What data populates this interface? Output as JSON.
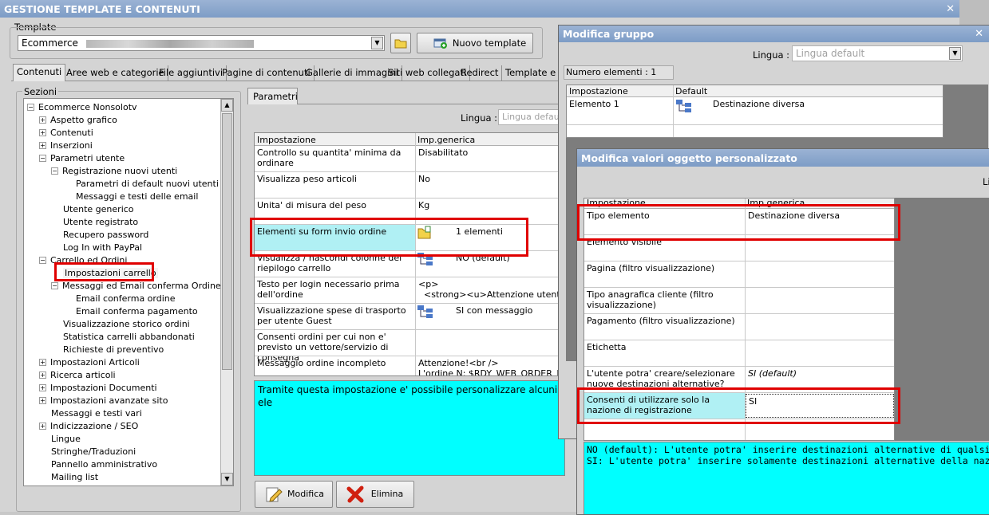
{
  "main_window": {
    "title": "GESTIONE TEMPLATE E CONTENUTI",
    "template_label": "Template",
    "template_value": "Ecommerce",
    "new_template_label": "Nuovo template"
  },
  "tabs": [
    "Contenuti",
    "Aree web e categorie",
    "File aggiuntivi",
    "Pagine di contenuti",
    "Gallerie di immagini",
    "Siti web collegati",
    "Redirect",
    "Template e pl"
  ],
  "sections_label": "Sezioni",
  "tree": [
    {
      "label": "Ecommerce Nonsolotv",
      "level": 0,
      "toggle": "−"
    },
    {
      "label": "Aspetto grafico",
      "level": 1,
      "toggle": "+"
    },
    {
      "label": "Contenuti",
      "level": 1,
      "toggle": "+"
    },
    {
      "label": "Inserzioni",
      "level": 1,
      "toggle": "+"
    },
    {
      "label": "Parametri utente",
      "level": 1,
      "toggle": "−"
    },
    {
      "label": "Registrazione nuovi utenti",
      "level": 2,
      "toggle": "−"
    },
    {
      "label": "Parametri di default nuovi utenti",
      "level": 3,
      "toggle": ""
    },
    {
      "label": "Messaggi e testi delle email",
      "level": 3,
      "toggle": ""
    },
    {
      "label": "Utente generico",
      "level": 2,
      "toggle": ""
    },
    {
      "label": "Utente registrato",
      "level": 2,
      "toggle": ""
    },
    {
      "label": "Recupero password",
      "level": 2,
      "toggle": ""
    },
    {
      "label": "Log In with PayPal",
      "level": 2,
      "toggle": ""
    },
    {
      "label": "Carrello ed Ordini",
      "level": 1,
      "toggle": "−"
    },
    {
      "label": "Impostazioni carrello",
      "level": 2,
      "toggle": "",
      "selected": true
    },
    {
      "label": "Messaggi ed Email conferma Ordine",
      "level": 2,
      "toggle": "−"
    },
    {
      "label": "Email conferma ordine",
      "level": 3,
      "toggle": ""
    },
    {
      "label": "Email conferma pagamento",
      "level": 3,
      "toggle": ""
    },
    {
      "label": "Visualizzazione storico ordini",
      "level": 2,
      "toggle": ""
    },
    {
      "label": "Statistica carrelli abbandonati",
      "level": 2,
      "toggle": ""
    },
    {
      "label": "Richieste di preventivo",
      "level": 2,
      "toggle": ""
    },
    {
      "label": "Impostazioni Articoli",
      "level": 1,
      "toggle": "+"
    },
    {
      "label": "Ricerca articoli",
      "level": 1,
      "toggle": "+"
    },
    {
      "label": "Impostazioni Documenti",
      "level": 1,
      "toggle": "+"
    },
    {
      "label": "Impostazioni avanzate sito",
      "level": 1,
      "toggle": "+"
    },
    {
      "label": "Messaggi e testi vari",
      "level": 1,
      "toggle": ""
    },
    {
      "label": "Indicizzazione / SEO",
      "level": 1,
      "toggle": "+"
    },
    {
      "label": "Lingue",
      "level": 1,
      "toggle": ""
    },
    {
      "label": "Stringhe/Traduzioni",
      "level": 1,
      "toggle": ""
    },
    {
      "label": "Pannello amministrativo",
      "level": 1,
      "toggle": ""
    },
    {
      "label": "Mailing list",
      "level": 1,
      "toggle": ""
    }
  ],
  "parametri": {
    "tab_label": "Parametri",
    "lingua_label": "Lingua :",
    "lingua_value": "Lingua defau",
    "col_impostazione": "Impostazione",
    "col_generica": "Imp.generica",
    "rows": [
      {
        "name": "Controllo su quantita' minima da ordinare",
        "value": "Disabilitato",
        "icon": ""
      },
      {
        "name": "Visualizza peso articoli",
        "value": "No",
        "icon": ""
      },
      {
        "name": "Unita' di misura del peso",
        "value": "Kg",
        "icon": ""
      },
      {
        "name": "Elementi su form invio ordine",
        "value": "1 elementi",
        "icon": "folder-icon",
        "highlight": true
      },
      {
        "name": "Visualizza / nascondi colonne del riepilogo carrello",
        "value": "NO (default)",
        "icon": "tree-icon"
      },
      {
        "name": "Testo per login necessario prima dell'ordine",
        "value": "<p>\n  <strong><u>Attenzione utente",
        "icon": ""
      },
      {
        "name": "Visualizzazione spese di trasporto per utente Guest",
        "value": "SI con messaggio",
        "icon": "tree-icon"
      },
      {
        "name": "Consenti ordini per cui non e' previsto un vettore/servizio di consegna",
        "value": "",
        "icon": ""
      },
      {
        "name": "Messaggio ordine incompleto",
        "value": "Attenzione!<br />\nL'ordine N: $RDY_WEB_ORDER_ID$",
        "icon": ""
      }
    ],
    "description": "Tramite questa impostazione e' possibile personalizzare alcuni ele",
    "modifica_label": "Modifica",
    "elimina_label": "Elimina"
  },
  "modifica_gruppo": {
    "title": "Modifica gruppo",
    "lingua_label": "Lingua :",
    "lingua_value": "Lingua default",
    "count_label": "Numero elementi : 1",
    "col_impostazione": "Impostazione",
    "col_default": "Default",
    "rows": [
      {
        "name": "Elemento 1",
        "value": "Destinazione diversa"
      }
    ]
  },
  "modifica_valori": {
    "title": "Modifica valori oggetto personalizzato",
    "lingua_fragment": "Li",
    "col_impostazione": "Impostazione",
    "col_generica": "Imp.generica",
    "rows": [
      {
        "name": "Tipo elemento",
        "value": "Destinazione diversa"
      },
      {
        "name": "Elemento visibile",
        "value": ""
      },
      {
        "name": "Pagina (filtro visualizzazione)",
        "value": ""
      },
      {
        "name": "Tipo anagrafica cliente (filtro visualizzazione)",
        "value": ""
      },
      {
        "name": "Pagamento (filtro visualizzazione)",
        "value": ""
      },
      {
        "name": "Etichetta",
        "value": ""
      },
      {
        "name": "L'utente potra' creare/selezionare nuove destinazioni alternative?",
        "value": "SI (default)"
      },
      {
        "name": "Consenti di utilizzare solo la nazione di registrazione",
        "value": "SI"
      }
    ],
    "description_line1": "NO (default): L'utente potra' inserire destinazioni alternative di qualsiasi nazione",
    "description_line2": "SI: L'utente potra' inserire solamente destinazioni alternative della nazione di registrazio"
  },
  "colors": {
    "title_bar": "#7d9cc6",
    "cyan_panel": "#00ffff",
    "highlight": "#b0f0f4",
    "red_annotation": "#e00000"
  }
}
